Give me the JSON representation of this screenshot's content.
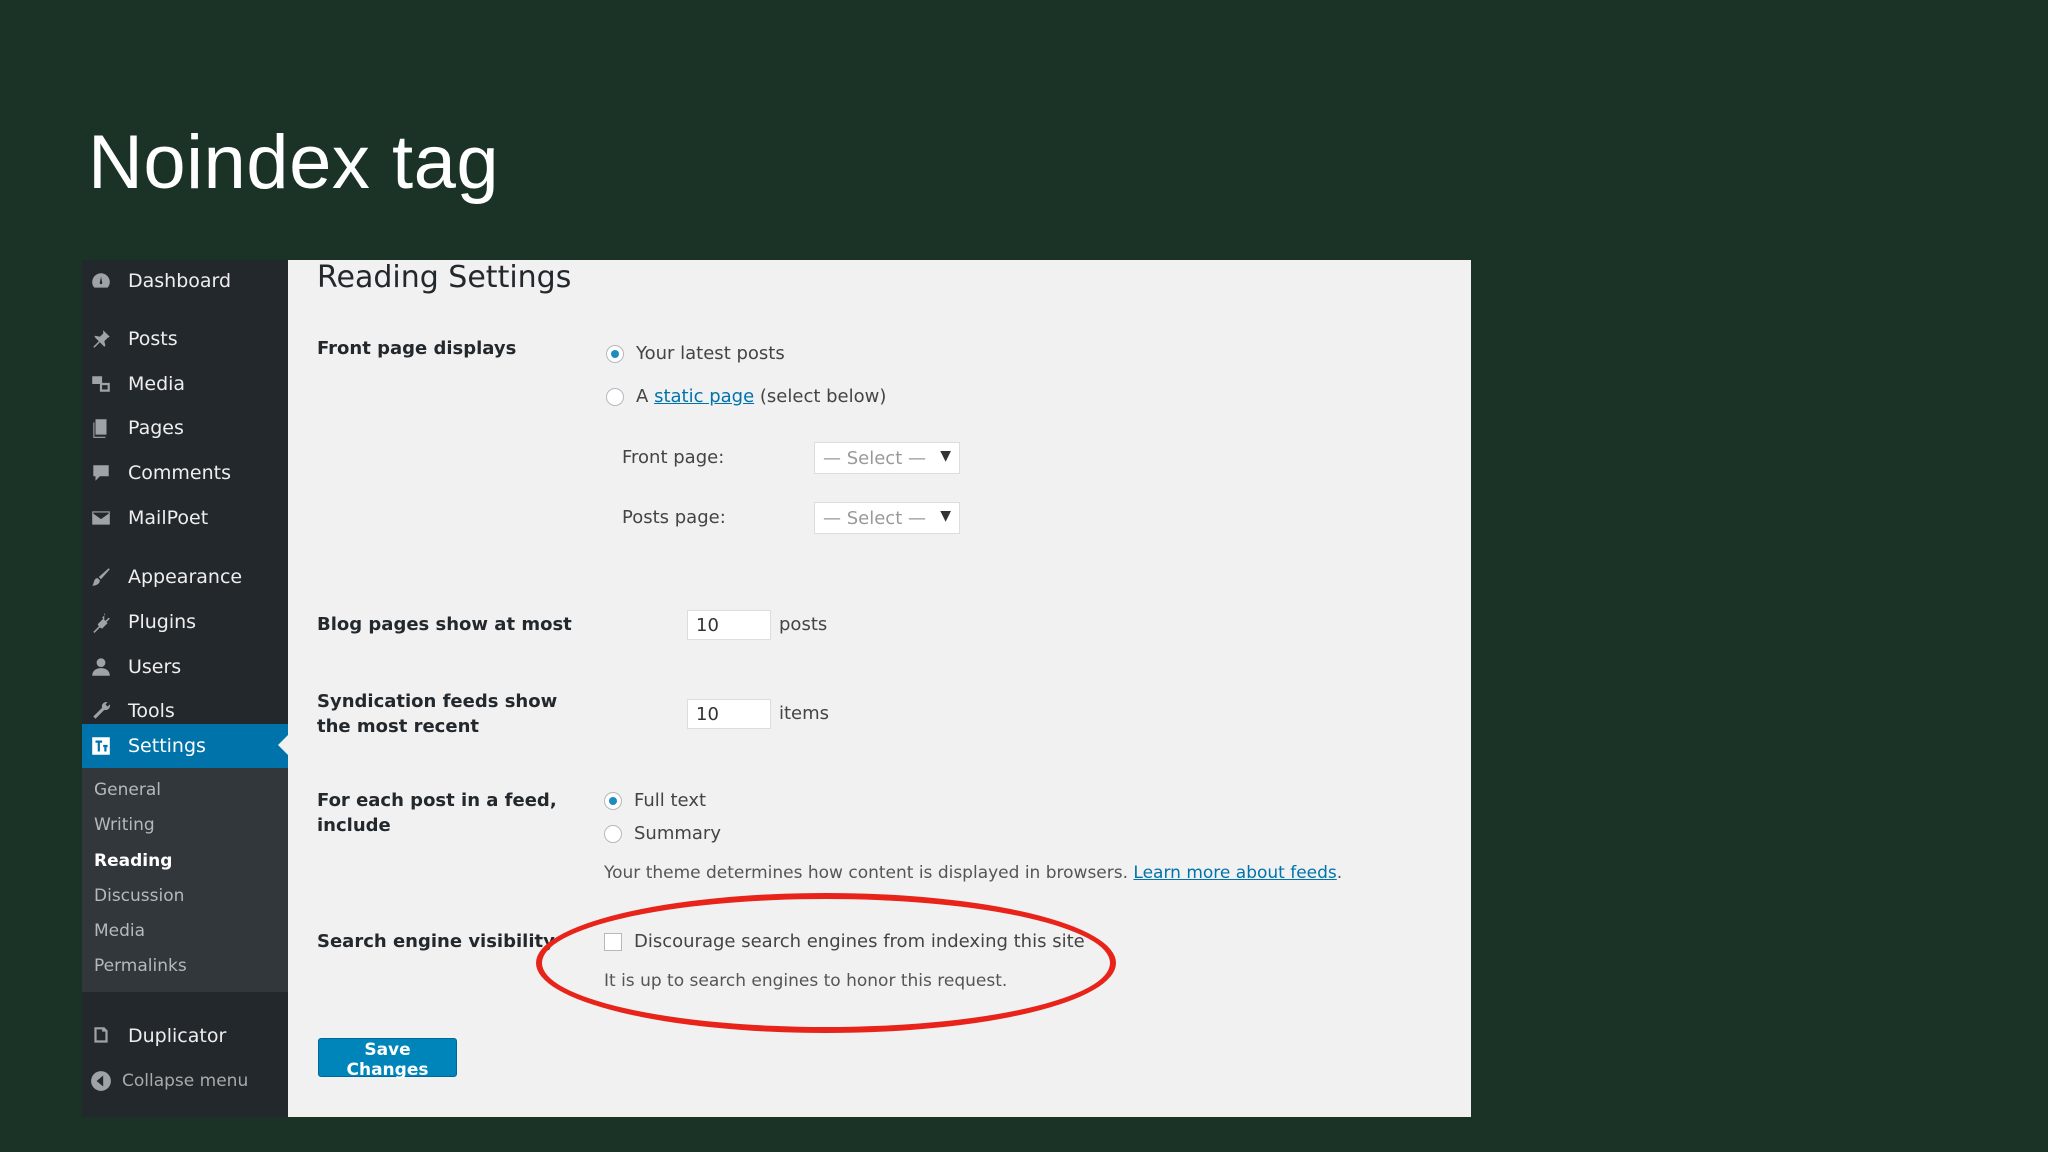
{
  "slide": {
    "title": "Noindex tag"
  },
  "sidebar": {
    "items": [
      {
        "label": "Dashboard",
        "icon": "dashboard-icon"
      },
      {
        "label": "Posts",
        "icon": "pin-icon"
      },
      {
        "label": "Media",
        "icon": "media-icon"
      },
      {
        "label": "Pages",
        "icon": "pages-icon"
      },
      {
        "label": "Comments",
        "icon": "comment-icon"
      },
      {
        "label": "MailPoet",
        "icon": "envelope-icon"
      },
      {
        "label": "Appearance",
        "icon": "brush-icon"
      },
      {
        "label": "Plugins",
        "icon": "plugin-icon"
      },
      {
        "label": "Users",
        "icon": "user-icon"
      },
      {
        "label": "Tools",
        "icon": "wrench-icon"
      },
      {
        "label": "Settings",
        "icon": "settings-icon",
        "active": true
      }
    ],
    "submenu": [
      {
        "label": "General"
      },
      {
        "label": "Writing"
      },
      {
        "label": "Reading",
        "current": true
      },
      {
        "label": "Discussion"
      },
      {
        "label": "Media"
      },
      {
        "label": "Permalinks"
      }
    ],
    "duplicator": {
      "label": "Duplicator",
      "icon": "duplicator-icon"
    },
    "collapse": {
      "label": "Collapse menu",
      "icon": "collapse-arrow-icon"
    }
  },
  "main": {
    "heading": "Reading Settings",
    "front_page": {
      "label": "Front page displays",
      "option_latest": "Your latest posts",
      "option_static_prefix": "A",
      "option_static_link": "static page",
      "option_static_suffix": "(select below)",
      "selected": "latest",
      "front_page_label": "Front page:",
      "front_page_value": "— Select —",
      "posts_page_label": "Posts page:",
      "posts_page_value": "— Select —"
    },
    "blog_pages": {
      "label": "Blog pages show at most",
      "value": "10",
      "unit": "posts"
    },
    "syndication": {
      "label": "Syndication feeds show the most recent",
      "value": "10",
      "unit": "items"
    },
    "feed_content": {
      "label": "For each post in a feed, include",
      "option_full": "Full text",
      "option_summary": "Summary",
      "selected": "full",
      "description": "Your theme determines how content is displayed in browsers.",
      "link": "Learn more about feeds"
    },
    "search_visibility": {
      "label": "Search engine visibility",
      "checkbox_label": "Discourage search engines from indexing this site",
      "checked": false,
      "description": "It is up to search engines to honor this request."
    },
    "save_label": "Save Changes"
  },
  "colors": {
    "slide_background": "#1b3326",
    "sidebar_background": "#23282d",
    "accent": "#0073aa",
    "highlight_circle": "#e8231a"
  }
}
